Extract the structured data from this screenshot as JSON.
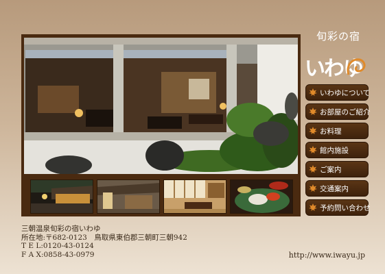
{
  "header": {
    "subtitle": "旬彩の宿",
    "logo_text": "いわゆ",
    "accent_color": "#e08a2a"
  },
  "menu": {
    "items": [
      {
        "label": "いわゆについて",
        "icon": "maple-leaf-icon"
      },
      {
        "label": "お部屋のご紹介",
        "icon": "maple-leaf-icon"
      },
      {
        "label": "お料理",
        "icon": "maple-leaf-icon"
      },
      {
        "label": "館内施設",
        "icon": "maple-leaf-icon"
      },
      {
        "label": "ご案内",
        "icon": "maple-leaf-icon"
      },
      {
        "label": "交通案内",
        "icon": "maple-leaf-icon"
      },
      {
        "label": "予約問い合わせ",
        "icon": "maple-leaf-icon"
      }
    ]
  },
  "photos": {
    "main": "lobby-garden-photo",
    "thumbnails": [
      "exterior-night-photo",
      "entrance-photo",
      "guest-room-photo",
      "cuisine-photo"
    ]
  },
  "footer": {
    "name": "三朝温泉旬彩の宿いわゆ",
    "address": "所在地:〒682-0123　鳥取県東伯郡三朝町三朝942",
    "tel": "T E L:0120-43-0124",
    "fax": "F A X:0858-43-0979",
    "url": "http://www.iwayu.jp"
  }
}
